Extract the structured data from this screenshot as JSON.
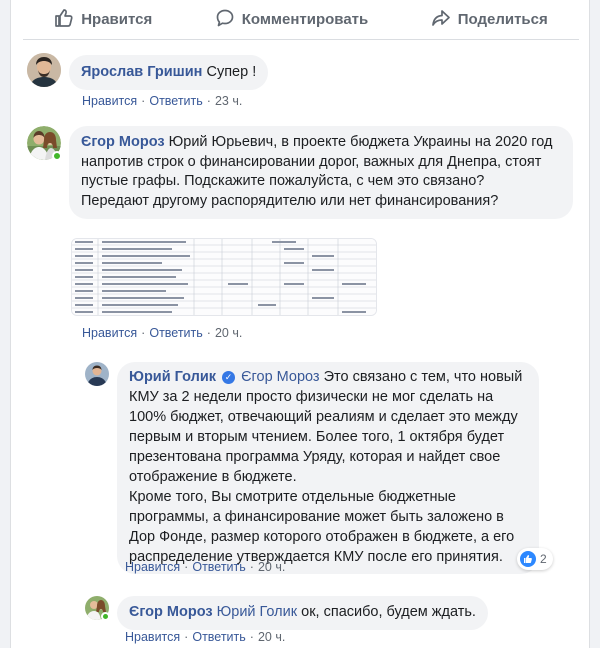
{
  "actions": {
    "like": "Нравится",
    "comment": "Комментировать",
    "share": "Поделиться"
  },
  "comments": [
    {
      "author": "Ярослав Гришин",
      "text": "Супер !",
      "like": "Нравится",
      "reply": "Ответить",
      "time": "23 ч."
    },
    {
      "author": "Єгор Мороз",
      "text": "Юрий Юрьевич, в проекте бюджета Украины на 2020 год напротив строк о финансировании дорог, важных для Днепра, стоят пустые графы. Подскажите пожалуйста, с чем это связано?",
      "text2": "Передают другому распорядителю или нет финансирования?",
      "like": "Нравится",
      "reply": "Ответить",
      "time": "20 ч."
    },
    {
      "author": "Юрий Голик",
      "verified_icon": "verified-badge-icon",
      "mention": "Єгор Мороз",
      "text": "Это связано с тем, что новый КМУ за 2 недели просто физически не мог сделать на 100% бюджет, отвечающий реалиям и сделает это между первым и вторым чтением. Более того, 1 октября будет презентована программа Уряду, которая и найдет свое отображение в бюджете.",
      "text2": "Кроме того, Вы смотрите отдельные бюджетные программы, а финансирование может быть заложено в Дор Фонде, размер которого отображен в бюджете, а его распределение утверждается КМУ после его принятия.",
      "like": "Нравится",
      "reply": "Ответить",
      "time": "20 ч.",
      "reactions_count": "2"
    },
    {
      "author": "Єгор Мороз",
      "mention": "Юрий Голик",
      "text": "ок, спасибо, будем ждать.",
      "like": "Нравится",
      "reply": "Ответить",
      "time": "20 ч."
    }
  ],
  "colors": {
    "link": "#385898",
    "bubble": "#f2f3f5",
    "muted": "#606770",
    "online": "#42b72a",
    "like_blue": "#2d88ff"
  }
}
